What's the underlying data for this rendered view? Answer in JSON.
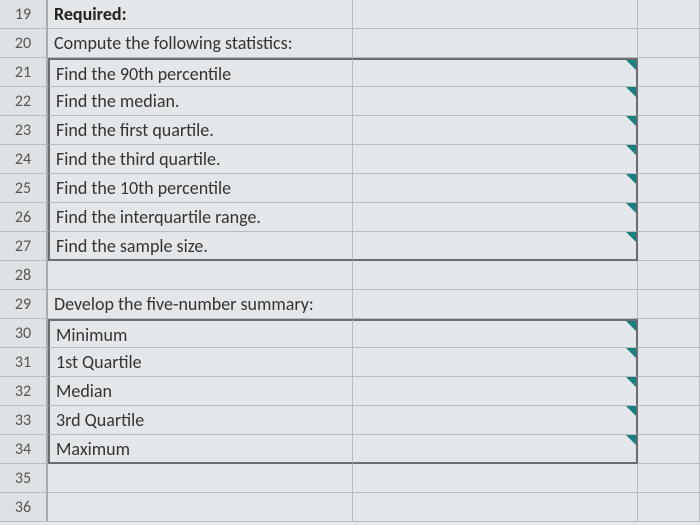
{
  "rows": [
    {
      "num": "19",
      "b": "Required:",
      "bold": true
    },
    {
      "num": "20",
      "b": "Compute the following statistics:"
    },
    {
      "num": "21",
      "b": "Find the 90th percentile",
      "flag": true,
      "box": "top"
    },
    {
      "num": "22",
      "b": "Find the median.",
      "flag": true,
      "box": "mid"
    },
    {
      "num": "23",
      "b": "Find the first quartile.",
      "flag": true,
      "box": "mid"
    },
    {
      "num": "24",
      "b": "Find the third quartile.",
      "flag": true,
      "box": "mid"
    },
    {
      "num": "25",
      "b": "Find the 10th percentile",
      "flag": true,
      "box": "mid"
    },
    {
      "num": "26",
      "b": "Find the interquartile range.",
      "flag": true,
      "box": "mid"
    },
    {
      "num": "27",
      "b": "Find the sample size.",
      "flag": true,
      "box": "bottom"
    },
    {
      "num": "28",
      "b": ""
    },
    {
      "num": "29",
      "b": "Develop the five-number summary:"
    },
    {
      "num": "30",
      "b": "Minimum",
      "flag": true,
      "box": "top"
    },
    {
      "num": "31",
      "b": "1st Quartile",
      "flag": true,
      "box": "mid"
    },
    {
      "num": "32",
      "b": "Median",
      "flag": true,
      "box": "mid"
    },
    {
      "num": "33",
      "b": "3rd Quartile",
      "flag": true,
      "box": "mid"
    },
    {
      "num": "34",
      "b": "Maximum",
      "flag": true,
      "box": "bottom"
    },
    {
      "num": "35",
      "b": ""
    },
    {
      "num": "36",
      "b": ""
    }
  ]
}
